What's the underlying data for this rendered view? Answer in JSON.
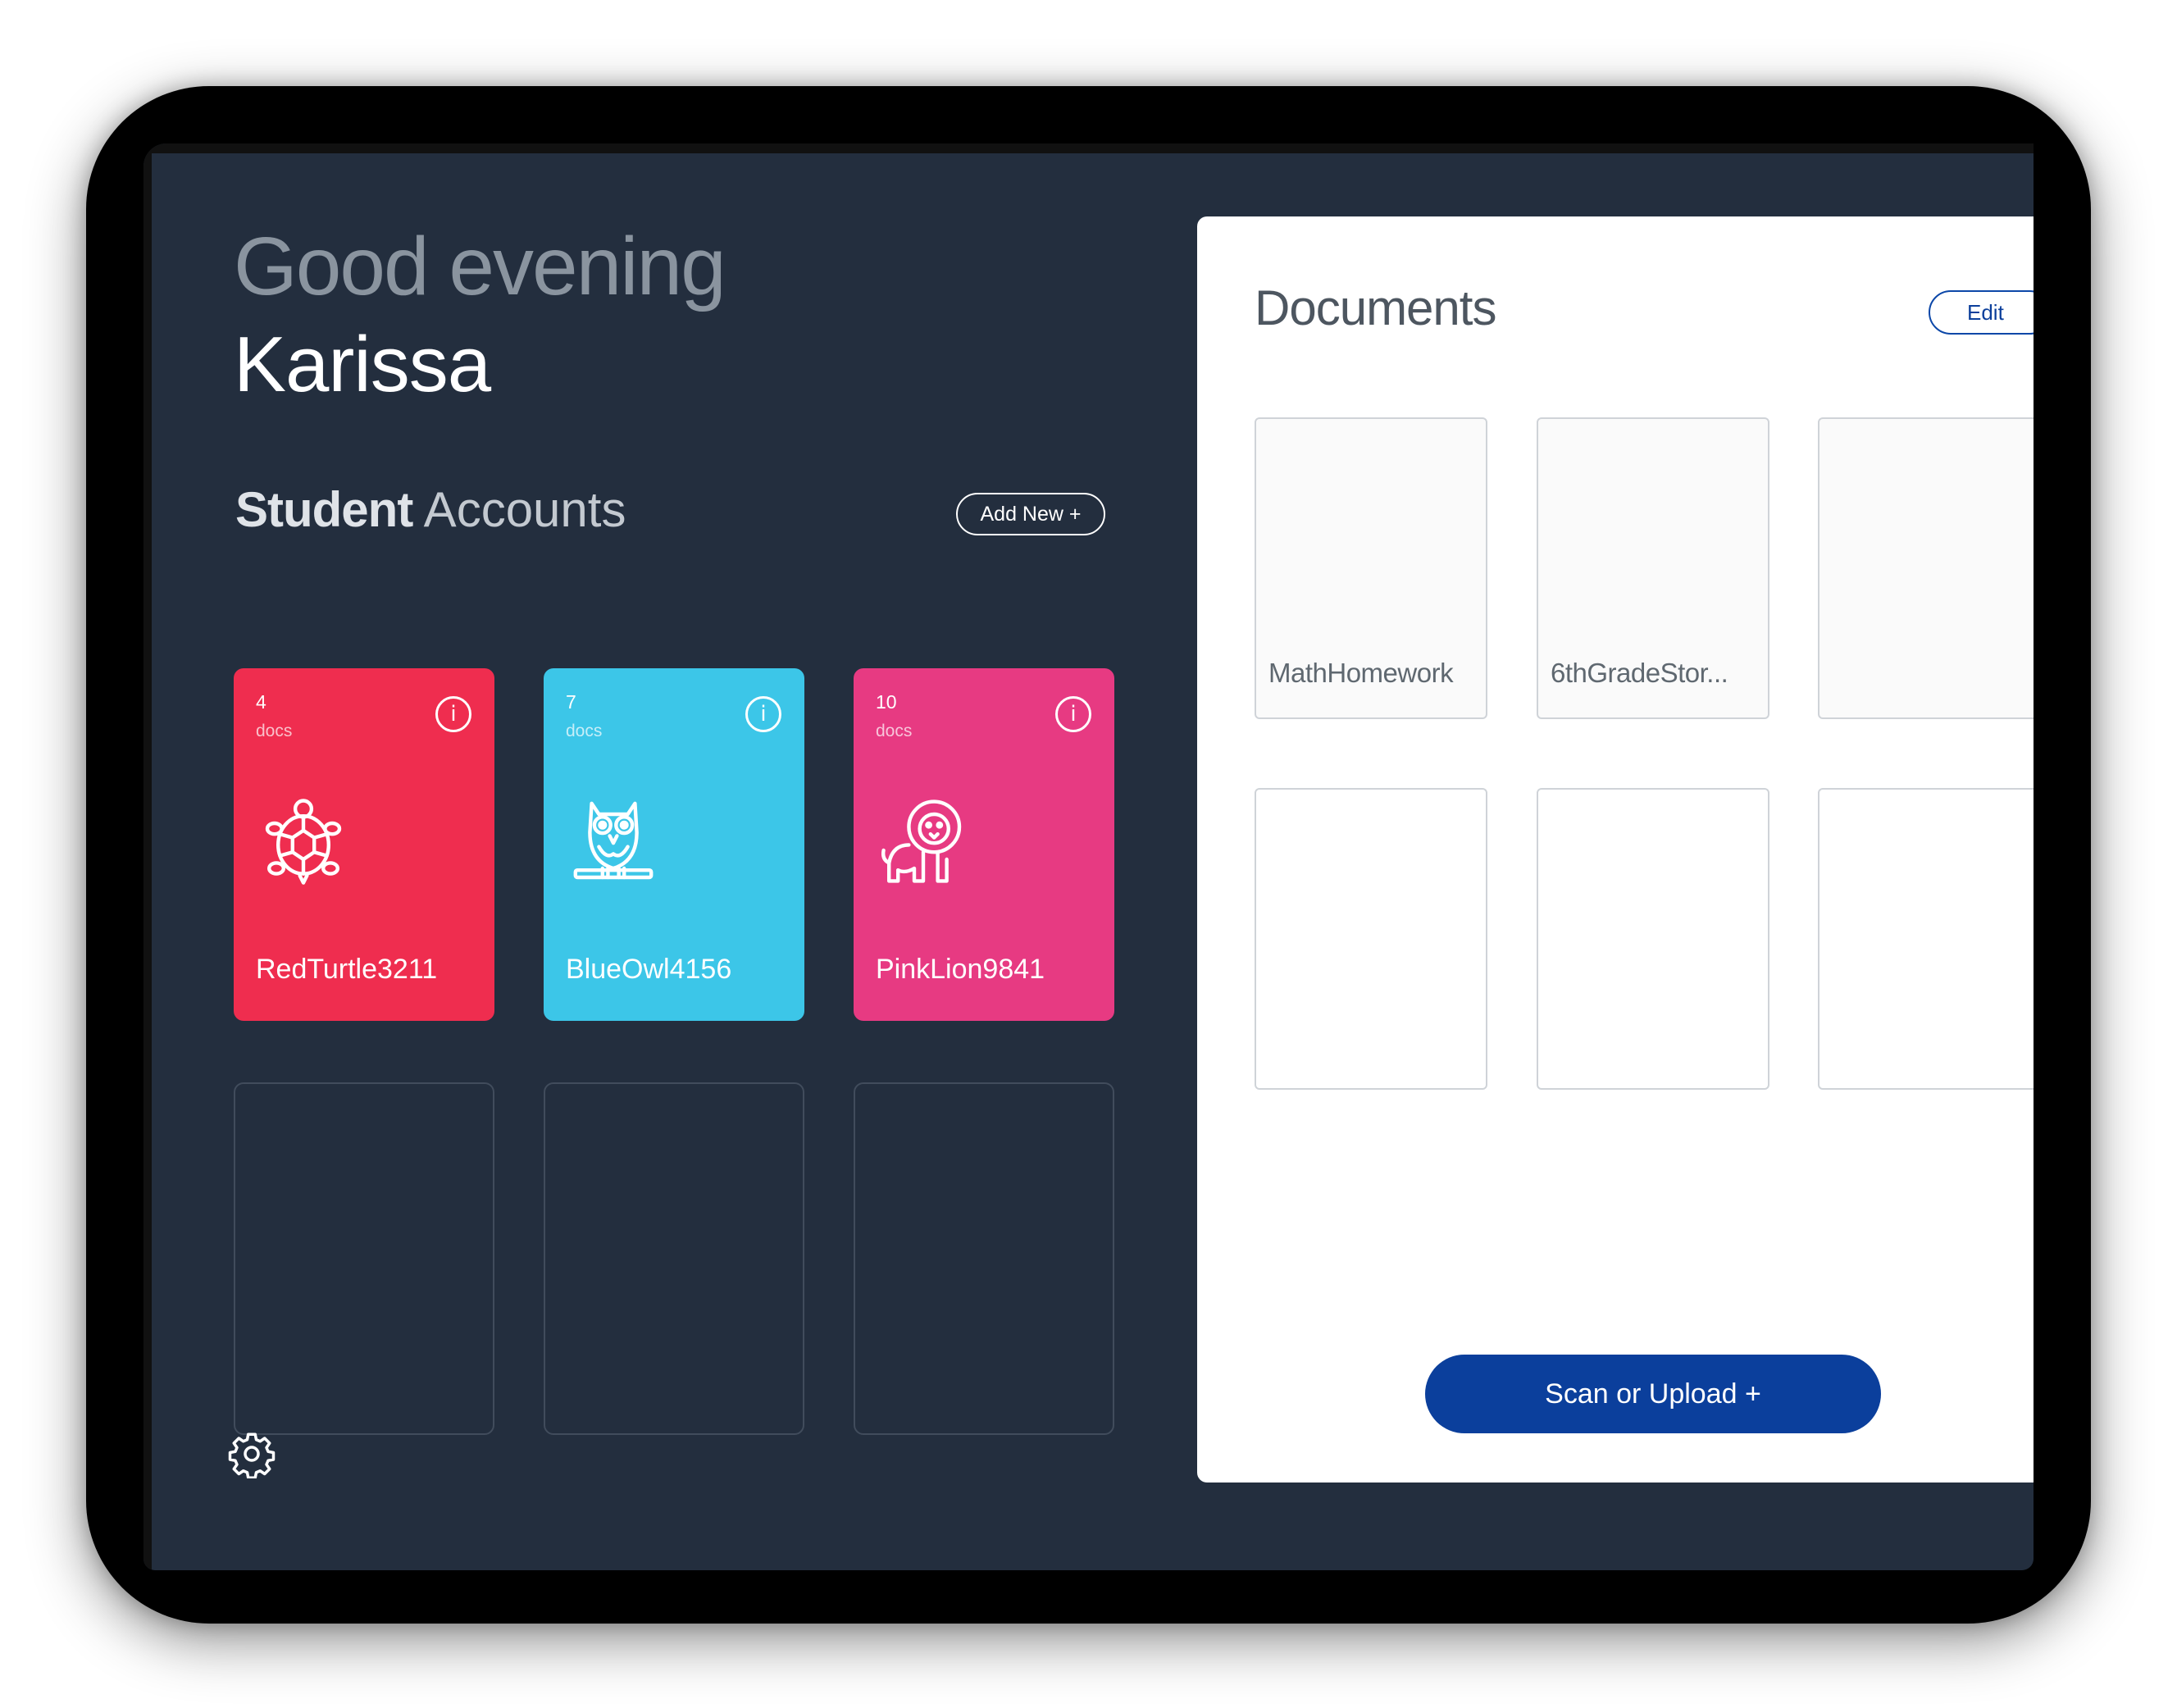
{
  "greeting": "Good evening",
  "user_name": "Karissa",
  "accounts": {
    "title_bold": "Student",
    "title_light": "Accounts",
    "add_label": "Add New +",
    "items": [
      {
        "count": "4",
        "unit": "docs",
        "name": "RedTurtle3211",
        "color": "#ef2d4f",
        "icon": "turtle-icon"
      },
      {
        "count": "7",
        "unit": "docs",
        "name": "BlueOwl4156",
        "color": "#3cc6e8",
        "icon": "owl-icon"
      },
      {
        "count": "10",
        "unit": "docs",
        "name": "PinkLion9841",
        "color": "#e73a82",
        "icon": "lion-icon"
      }
    ]
  },
  "documents": {
    "title": "Documents",
    "edit_label": "Edit",
    "items": [
      "MathHomework",
      "6thGradeStor..."
    ],
    "scan_label": "Scan or Upload +"
  },
  "icons": {
    "info": "info-icon",
    "settings": "gear-icon"
  }
}
